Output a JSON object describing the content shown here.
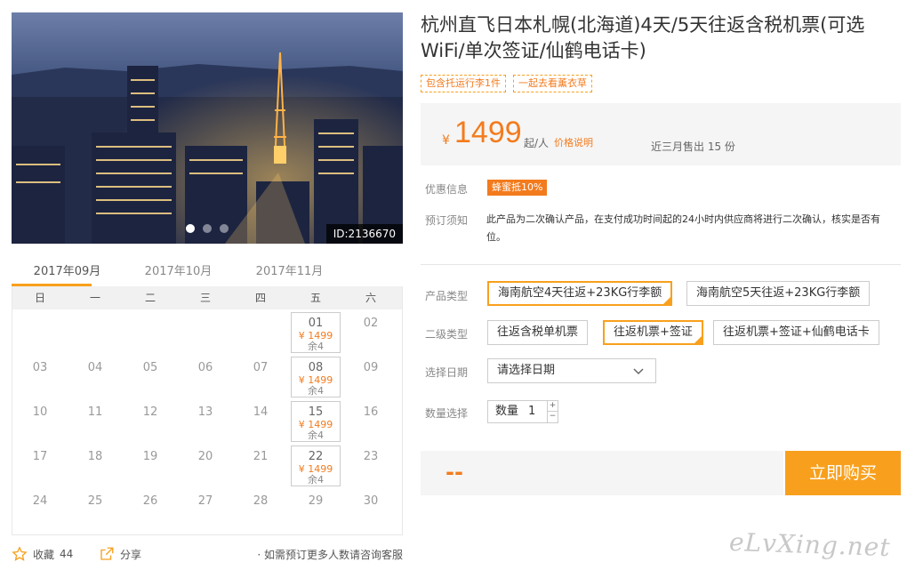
{
  "hero": {
    "id_label": "ID:2136670",
    "slide_count": 3,
    "active_slide": 0
  },
  "calendar": {
    "tabs": [
      "2017年09月",
      "2017年10月",
      "2017年11月"
    ],
    "active_tab": 0,
    "weekdays": [
      "日",
      "一",
      "二",
      "三",
      "四",
      "五",
      "六"
    ],
    "rows": [
      [
        {
          "d": ""
        },
        {
          "d": ""
        },
        {
          "d": ""
        },
        {
          "d": ""
        },
        {
          "d": ""
        },
        {
          "d": "01",
          "price": "¥ 1499",
          "stock": "余4"
        },
        {
          "d": "02"
        }
      ],
      [
        {
          "d": "03"
        },
        {
          "d": "04"
        },
        {
          "d": "05"
        },
        {
          "d": "06"
        },
        {
          "d": "07"
        },
        {
          "d": "08",
          "price": "¥ 1499",
          "stock": "余4"
        },
        {
          "d": "09"
        }
      ],
      [
        {
          "d": "10"
        },
        {
          "d": "11"
        },
        {
          "d": "12"
        },
        {
          "d": "13"
        },
        {
          "d": "14"
        },
        {
          "d": "15",
          "price": "¥ 1499",
          "stock": "余4"
        },
        {
          "d": "16"
        }
      ],
      [
        {
          "d": "17"
        },
        {
          "d": "18"
        },
        {
          "d": "19"
        },
        {
          "d": "20"
        },
        {
          "d": "21"
        },
        {
          "d": "22",
          "price": "¥ 1499",
          "stock": "余4"
        },
        {
          "d": "23"
        }
      ],
      [
        {
          "d": "24"
        },
        {
          "d": "25"
        },
        {
          "d": "26"
        },
        {
          "d": "27"
        },
        {
          "d": "28"
        },
        {
          "d": "29"
        },
        {
          "d": "30"
        }
      ]
    ]
  },
  "social": {
    "favorite_label": "收藏",
    "favorite_count": "44",
    "share_label": "分享",
    "consult": "· 如需预订更多人数请咨询客服"
  },
  "product": {
    "title": "杭州直飞日本札幌(北海道)4天/5天往返含税机票(可选WiFi/单次签证/仙鹤电话卡)",
    "tags": [
      "包含托运行李1件",
      "一起去看薰衣草"
    ]
  },
  "price": {
    "currency": "¥",
    "amount": "1499",
    "per": "起/人",
    "explain": "价格说明",
    "sold": "近三月售出 15 份"
  },
  "info": {
    "promo_label": "优惠信息",
    "promo_badge": "蜂蜜抵10%",
    "notice_label": "预订须知",
    "notice_text": "此产品为二次确认产品，在支付成功时间起的24小时内供应商将进行二次确认，核实是否有位。"
  },
  "options": {
    "product_type_label": "产品类型",
    "product_types": [
      "海南航空4天往返+23KG行李额",
      "海南航空5天往返+23KG行李额"
    ],
    "product_type_selected": 0,
    "sub_type_label": "二级类型",
    "sub_types": [
      "往返含税单机票",
      "往返机票+签证",
      "往返机票+签证+仙鹤电话卡"
    ],
    "sub_type_selected": 1,
    "date_label": "选择日期",
    "date_placeholder": "请选择日期",
    "qty_label": "数量选择",
    "qty_text": "数量",
    "qty_value": "1"
  },
  "purchase": {
    "total": "--",
    "buy_label": "立即购买"
  },
  "watermark": "eLvXing.net",
  "colors": {
    "accent": "#f8a01d",
    "price": "#f37b1d"
  }
}
